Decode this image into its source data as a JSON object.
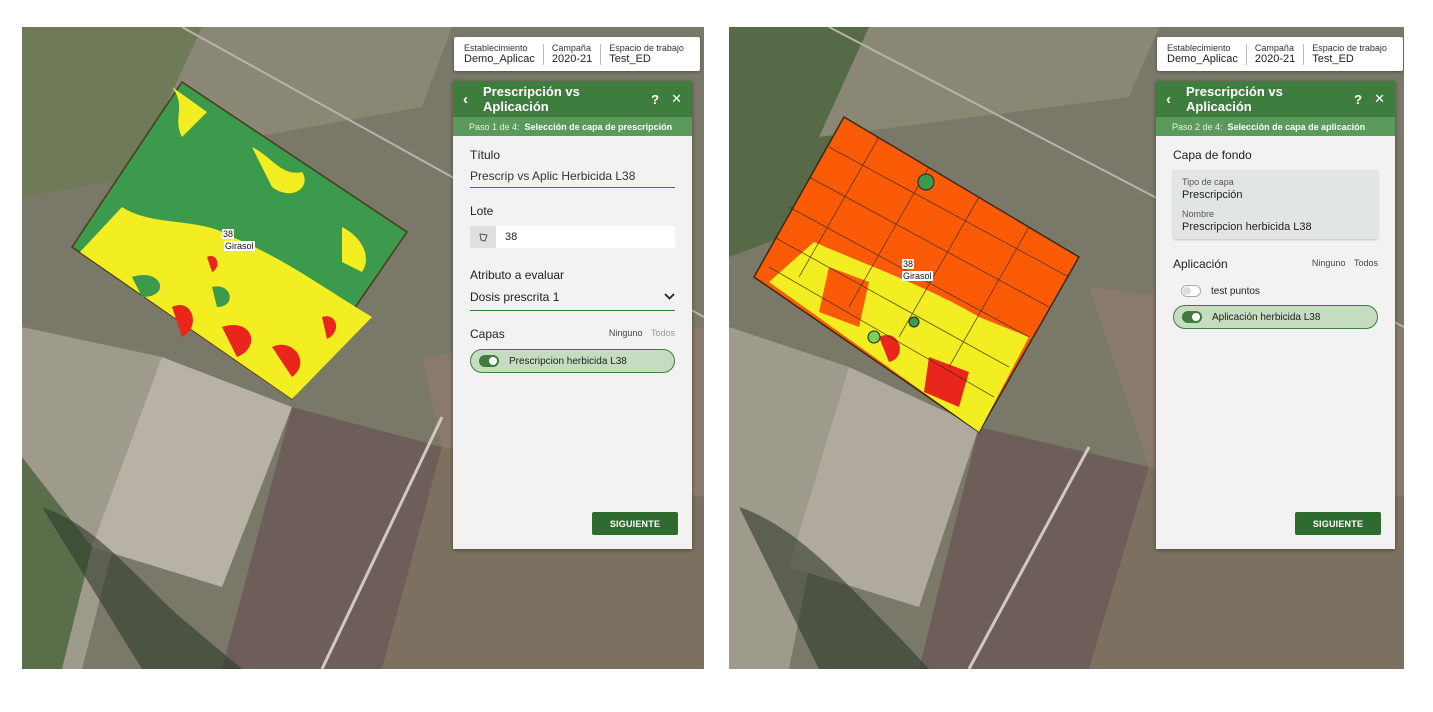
{
  "left": {
    "header": {
      "establecimiento_label": "Establecimiento",
      "establecimiento_value": "Demo_Aplicac",
      "campana_label": "Campaña",
      "campana_value": "2020-21",
      "espacio_label": "Espacio de trabajo",
      "espacio_value": "Test_ED"
    },
    "panel": {
      "back": "‹",
      "title": "Prescripción vs Aplicación",
      "help": "?",
      "close": "✕",
      "step_number": "Paso 1 de 4:",
      "step_desc": "Selección de capa de prescripción",
      "titulo_label": "Título",
      "titulo_value": "Prescrip vs Aplic Herbicida L38",
      "lote_label": "Lote",
      "lote_value": "38",
      "atributo_label": "Atributo a evaluar",
      "atributo_value": "Dosis prescrita 1",
      "capas_label": "Capas",
      "ninguno": "Ninguno",
      "todos": "Todos",
      "layer": "Prescripcion herbicida L38",
      "button": "SIGUIENTE"
    },
    "map_label_num": "38",
    "map_label_crop": "Girasol"
  },
  "right": {
    "header": {
      "establecimiento_label": "Establecimiento",
      "establecimiento_value": "Demo_Aplicac",
      "campana_label": "Campaña",
      "campana_value": "2020-21",
      "espacio_label": "Espacio de trabajo",
      "espacio_value": "Test_ED"
    },
    "panel": {
      "back": "‹",
      "title": "Prescripción vs Aplicación",
      "help": "?",
      "close": "✕",
      "step_number": "Paso 2 de 4:",
      "step_desc": "Selección de capa de aplicación",
      "capa_fondo_label": "Capa de fondo",
      "tipo_label": "Tipo de capa",
      "tipo_value": "Prescripción",
      "nombre_label": "Nombre",
      "nombre_value": "Prescripcion herbicida L38",
      "aplicacion_label": "Aplicación",
      "ninguno": "Ninguno",
      "todos": "Todos",
      "layer_off": "test puntos",
      "layer_on": "Aplicación herbicida L38",
      "button": "SIGUIENTE"
    },
    "map_label_num": "38",
    "map_label_crop": "Girasol"
  },
  "colors": {
    "accent": "#3e7d3e",
    "field_green": "#3c9a4c",
    "field_yellow": "#f2ee22",
    "field_red": "#e8261c",
    "field_orange": "#fb5a06"
  }
}
